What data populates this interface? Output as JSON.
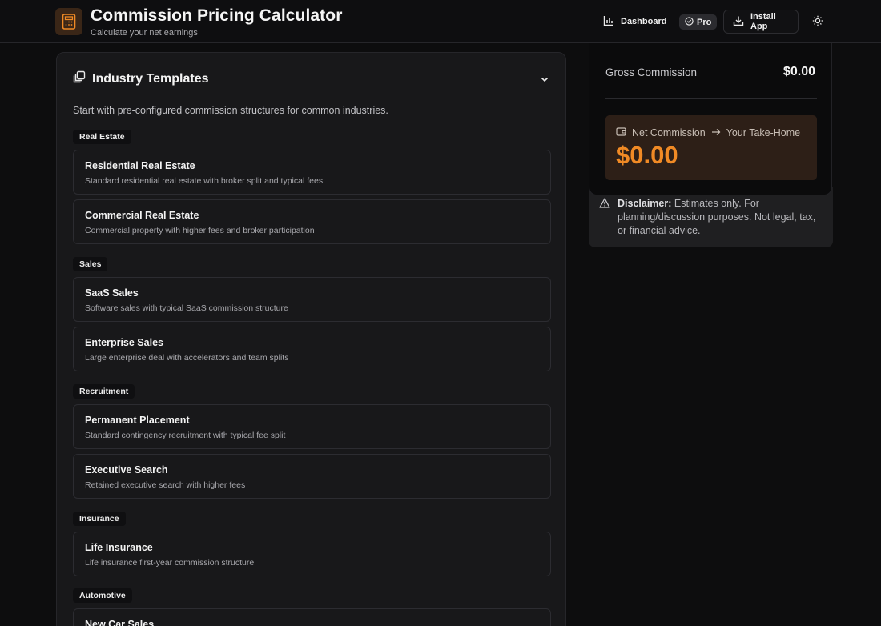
{
  "header": {
    "title": "Commission Pricing Calculator",
    "subtitle": "Calculate your net earnings",
    "app_icon": "calculator-icon",
    "dashboard_label": "Dashboard",
    "pro_label": "Pro",
    "install_label": "Install App",
    "theme_icon": "sun-icon"
  },
  "templates": {
    "title": "Industry Templates",
    "intro": "Start with pre-configured commission structures for common industries.",
    "categories": [
      {
        "name": "Real Estate",
        "items": [
          {
            "name": "Residential Real Estate",
            "desc": "Standard residential real estate with broker split and typical fees"
          },
          {
            "name": "Commercial Real Estate",
            "desc": "Commercial property with higher fees and broker participation"
          }
        ]
      },
      {
        "name": "Sales",
        "items": [
          {
            "name": "SaaS Sales",
            "desc": "Software sales with typical SaaS commission structure"
          },
          {
            "name": "Enterprise Sales",
            "desc": "Large enterprise deal with accelerators and team splits"
          }
        ]
      },
      {
        "name": "Recruitment",
        "items": [
          {
            "name": "Permanent Placement",
            "desc": "Standard contingency recruitment with typical fee split"
          },
          {
            "name": "Executive Search",
            "desc": "Retained executive search with higher fees"
          }
        ]
      },
      {
        "name": "Insurance",
        "items": [
          {
            "name": "Life Insurance",
            "desc": "Life insurance first-year commission structure"
          }
        ]
      },
      {
        "name": "Automotive",
        "items": [
          {
            "name": "New Car Sales",
            "desc": ""
          }
        ]
      }
    ]
  },
  "results": {
    "gross_label": "Gross Commission",
    "gross_value": "$0.00",
    "net_label": "Net Commission",
    "net_sub": "Your Take-Home",
    "net_value": "$0.00"
  },
  "disclaimer": {
    "label": "Disclaimer:",
    "text": " Estimates only. For planning/discussion purposes. Not legal, tax, or financial advice."
  },
  "colors": {
    "accent": "#f08a25",
    "background": "#0d0d0e",
    "panel": "#18181a"
  }
}
